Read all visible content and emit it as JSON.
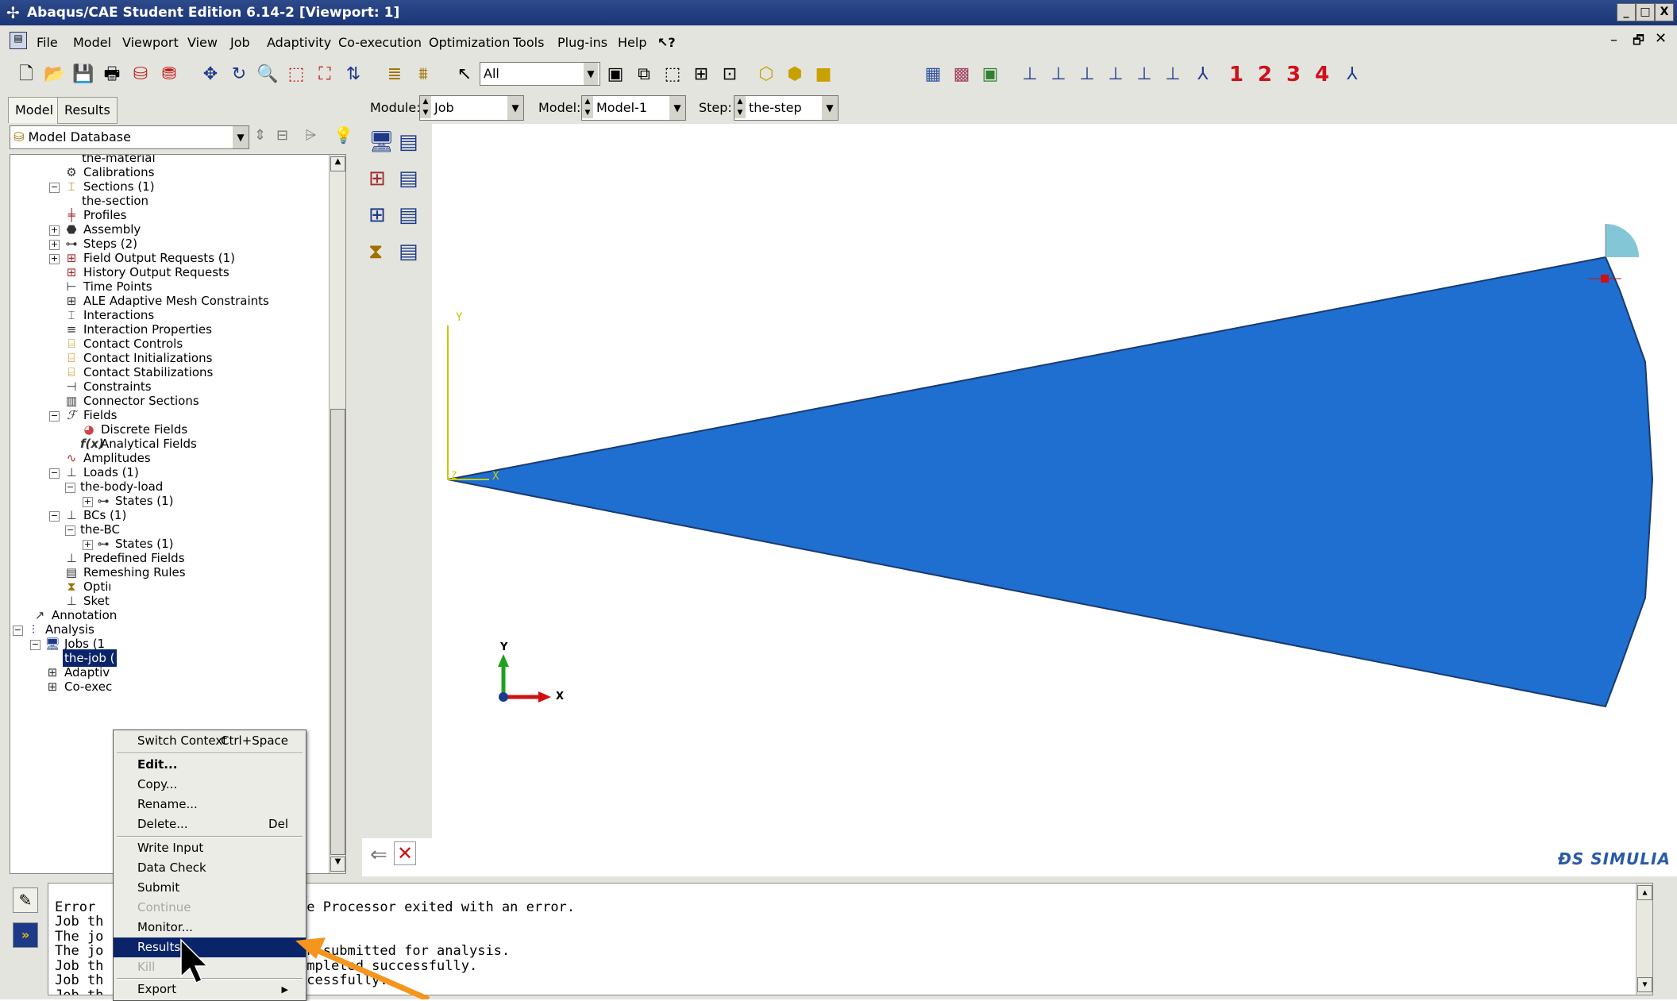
{
  "window": {
    "title": "Abaqus/CAE Student Edition 6.14-2 [Viewport: 1]",
    "controls": [
      "_",
      "□",
      "X"
    ],
    "inner_controls": [
      "–",
      "🗗",
      "✕"
    ]
  },
  "menubar": [
    "File",
    "Model",
    "Viewport",
    "View",
    "Job",
    "Adaptivity",
    "Co-execution",
    "Optimization",
    "Tools",
    "Plug-ins",
    "Help",
    "⁰?"
  ],
  "toolbar": {
    "selection_filter": "All",
    "view_numbers": [
      "1",
      "2",
      "3",
      "4"
    ]
  },
  "tabs": [
    "Model",
    "Results"
  ],
  "model_database_label": "Model Database",
  "context": {
    "module_label": "Module:",
    "module_value": "Job",
    "model_label": "Model:",
    "model_value": "Model-1",
    "step_label": "Step:",
    "step_value": "the-step"
  },
  "tree": [
    {
      "label": "the-material"
    },
    {
      "label": "Calibrations"
    },
    {
      "label": "Sections (1)"
    },
    {
      "label": "the-section"
    },
    {
      "label": "Profiles"
    },
    {
      "label": "Assembly"
    },
    {
      "label": "Steps (2)"
    },
    {
      "label": "Field Output Requests (1)"
    },
    {
      "label": "History Output Requests"
    },
    {
      "label": "Time Points"
    },
    {
      "label": "ALE Adaptive Mesh Constraints"
    },
    {
      "label": "Interactions"
    },
    {
      "label": "Interaction Properties"
    },
    {
      "label": "Contact Controls"
    },
    {
      "label": "Contact Initializations"
    },
    {
      "label": "Contact Stabilizations"
    },
    {
      "label": "Constraints"
    },
    {
      "label": "Connector Sections"
    },
    {
      "label": "Fields"
    },
    {
      "label": "Discrete Fields"
    },
    {
      "label": "Analytical Fields"
    },
    {
      "label": "Amplitudes"
    },
    {
      "label": "Loads (1)"
    },
    {
      "label": "the-body-load"
    },
    {
      "label": "States (1)"
    },
    {
      "label": "BCs (1)"
    },
    {
      "label": "the-BC"
    },
    {
      "label": "States (1)"
    },
    {
      "label": "Predefined Fields"
    },
    {
      "label": "Remeshing Rules"
    },
    {
      "label": "Optimization Tasks"
    },
    {
      "label": "Sket"
    },
    {
      "label": "Annotation"
    },
    {
      "label": "Analysis"
    },
    {
      "label": "Jobs (1"
    },
    {
      "label": "the-job ("
    },
    {
      "label": "Adaptiv"
    },
    {
      "label": "Co-exec"
    }
  ],
  "context_menu": [
    {
      "label": "Switch Context",
      "shortcut": "Ctrl+Space"
    },
    {
      "label": "Edit..."
    },
    {
      "label": "Copy..."
    },
    {
      "label": "Rename..."
    },
    {
      "label": "Delete...",
      "shortcut": "Del"
    },
    {
      "label": "Write Input"
    },
    {
      "label": "Data Check"
    },
    {
      "label": "Submit"
    },
    {
      "label": "Continue"
    },
    {
      "label": "Monitor..."
    },
    {
      "label": "Results"
    },
    {
      "label": "Kill"
    },
    {
      "label": "Export"
    }
  ],
  "messages": [
    "Error              is Input File Processor exited with an error.",
    "Job th             rrors.",
    "The jo             reated.",
    "The jo             inp\" has been submitted for analysis.",
    "Job th             Processor completed successfully.",
    "Job th             c    ted successfully.",
    "Job th             sfully."
  ],
  "viewport": {
    "triad_x": "X",
    "triad_y": "Y",
    "local_x": "X",
    "local_y": "Y",
    "local_z": "Z",
    "brand": "SIMULIA",
    "shape_color": "#1e6fd0"
  }
}
